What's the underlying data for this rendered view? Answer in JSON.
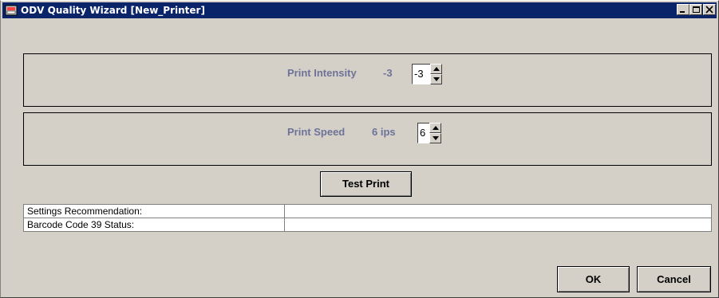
{
  "window": {
    "title": "ODV Quality Wizard [New_Printer]",
    "controls": [
      "minimize-icon",
      "maximize-icon",
      "close-icon"
    ]
  },
  "intensity": {
    "label": "Print Intensity",
    "value_text": "-3",
    "spinner_value": "-3"
  },
  "speed": {
    "label": "Print Speed",
    "value_text": "6 ips",
    "spinner_value": "6"
  },
  "test_print_label": "Test Print",
  "status_table": [
    {
      "label": "Settings Recommendation:",
      "value": ""
    },
    {
      "label": "Barcode Code 39 Status:",
      "value": ""
    }
  ],
  "footer": {
    "ok_label": "OK",
    "cancel_label": "Cancel"
  },
  "colors": {
    "title_bar": "#0a246a",
    "background": "#d4d0c8",
    "label_text": "#6d7398"
  }
}
